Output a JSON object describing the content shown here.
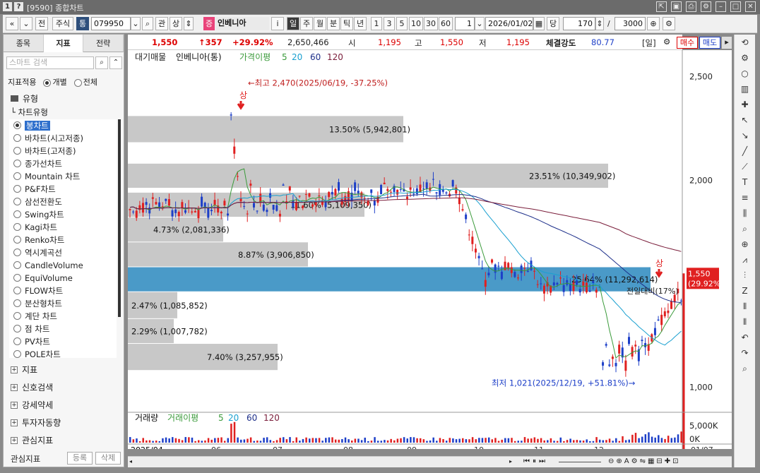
{
  "window": {
    "title": "[9590] 종합차트",
    "icon1": "1",
    "icon2": "?"
  },
  "toolbar": {
    "nav_prev": "«",
    "nav_down": "»",
    "jeon": "전",
    "jusik": "주식",
    "tong": "통",
    "code": "079950",
    "gwan": "관",
    "sang": "상",
    "jeung": "증",
    "stock_name": "인베니아",
    "info": "i",
    "periods": [
      "일",
      "주",
      "월",
      "분",
      "틱",
      "년"
    ],
    "active_period": "일",
    "intervals": [
      "1",
      "3",
      "5",
      "10",
      "30",
      "60"
    ],
    "interval_value": "1",
    "date": "2026/01/02",
    "dang_label": "당",
    "count": "170",
    "slash": "/",
    "total": "3000"
  },
  "leftpanel": {
    "tabs": [
      "종목",
      "지표",
      "전략"
    ],
    "active_tab": "지표",
    "search_placeholder": "스마트 검색",
    "apply_label": "지표적용",
    "apply_opt1": "개별",
    "apply_opt2": "전체",
    "type_section": "유형",
    "chart_type_label": "차트유형",
    "chart_types": [
      "봉차트",
      "바차트(시고저종)",
      "바차트(고저종)",
      "종가선차트",
      "Mountain 차트",
      "P&F차트",
      "삼선전환도",
      "Swing차트",
      "Kagi차트",
      "Renko차트",
      "역시계곡선",
      "CandleVolume",
      "EquiVolume",
      "FLOW차트",
      "분산형차트",
      "계단 차트",
      "점 차트",
      "PV차트",
      "POLE차트"
    ],
    "selected_type": "봉차트",
    "sections": [
      "지표",
      "신호검색",
      "강세약세",
      "투자자동향",
      "관심지표"
    ],
    "bottom_label": "관심지표",
    "register_button": "등록",
    "delete_button": "삭제"
  },
  "infobar": {
    "price": "1,550",
    "change": "↑357",
    "change_pct": "+29.92%",
    "volume": "2,650,466",
    "open_label": "시",
    "open": "1,195",
    "high_label": "고",
    "high": "1,550",
    "low_label": "저",
    "low": "1,195",
    "strength_label": "체결강도",
    "strength": "80.77",
    "period_tag": "[일]",
    "buy_button": "매수",
    "sell_button": "매도"
  },
  "legend": {
    "items": [
      "대기매물",
      "인베니아(통)",
      "가격이평",
      "5",
      "20",
      "60",
      "120"
    ],
    "volume_items": [
      "거래량",
      "거래이평",
      "5",
      "20",
      "60",
      "120"
    ]
  },
  "colors": {
    "up": "#e02020",
    "down": "#1d3fc8",
    "ma5": "#3a9a3a",
    "ma20": "#1aa0d0",
    "ma60": "#1d2f8a",
    "ma120": "#7a1d3a",
    "highlight": "#4a9ac8",
    "gray": "#c8c8c8"
  },
  "chart_data": {
    "type": "candlestick",
    "title": "인베니아(통)",
    "ylim": [
      900,
      2560
    ],
    "yticks": [
      "2,500",
      "2,000",
      "1,000"
    ],
    "xticks": [
      "2025/04",
      "06",
      "07",
      "08",
      "09",
      "10",
      "11",
      "12",
      "01/07"
    ],
    "volume_ticks": [
      "5,000K",
      "0K"
    ],
    "annotations": {
      "high": "←최고 2,470(2025/06/19, -37.25%)",
      "low": "최저 1,021(2025/12/19, +51.81%)→",
      "upper_limit_mark": "상",
      "current_price": "1,550",
      "current_pct": "(29.92%)"
    },
    "supply_bands": [
      {
        "label": "13.50% (5,942,801)",
        "low": 2180,
        "high": 2310
      },
      {
        "label": "23.51% (10,349,902)",
        "low": 1960,
        "high": 2080
      },
      {
        "label": "11.60% (5,109,350)",
        "low": 1820,
        "high": 1940
      },
      {
        "label": "4.73% (2,081,336)",
        "low": 1700,
        "high": 1820
      },
      {
        "label": "8.87% (3,906,850)",
        "low": 1580,
        "high": 1700
      },
      {
        "label": "25.64% (11,292,614)",
        "low": 1460,
        "high": 1580,
        "highlight": true
      },
      {
        "label": "2.47% (1,085,852)",
        "low": 1330,
        "high": 1460
      },
      {
        "label": "2.29% (1,007,782)",
        "low": 1210,
        "high": 1330
      },
      {
        "label": "7.40% (3,257,955)",
        "low": 1080,
        "high": 1210
      }
    ],
    "extra_label": "전일대비(17%)"
  }
}
